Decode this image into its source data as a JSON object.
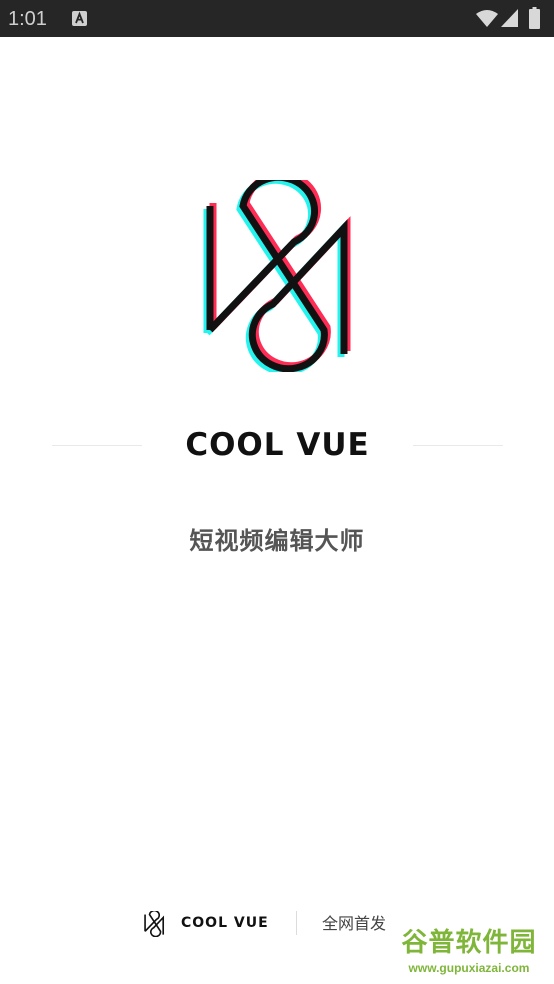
{
  "status_bar": {
    "time": "1:01",
    "icons": [
      "a-notification-icon",
      "wifi-icon",
      "cell-signal-icon",
      "battery-icon"
    ]
  },
  "splash": {
    "logo": "glitch-1984-logo",
    "brand": "COOL VUE",
    "tagline": "短视频编辑大师"
  },
  "footer": {
    "logo": "small-1984-logo",
    "brand": "COOL VUE",
    "note": "全网首发"
  },
  "watermark": {
    "site_name": "谷普软件园",
    "url": "www.gupuxiazai.com",
    "color": "#7fb63a"
  },
  "colors": {
    "logo_black": "#111111",
    "glitch_red": "#ff2d55",
    "glitch_cyan": "#25f4ee",
    "status_bar": "#262626"
  }
}
